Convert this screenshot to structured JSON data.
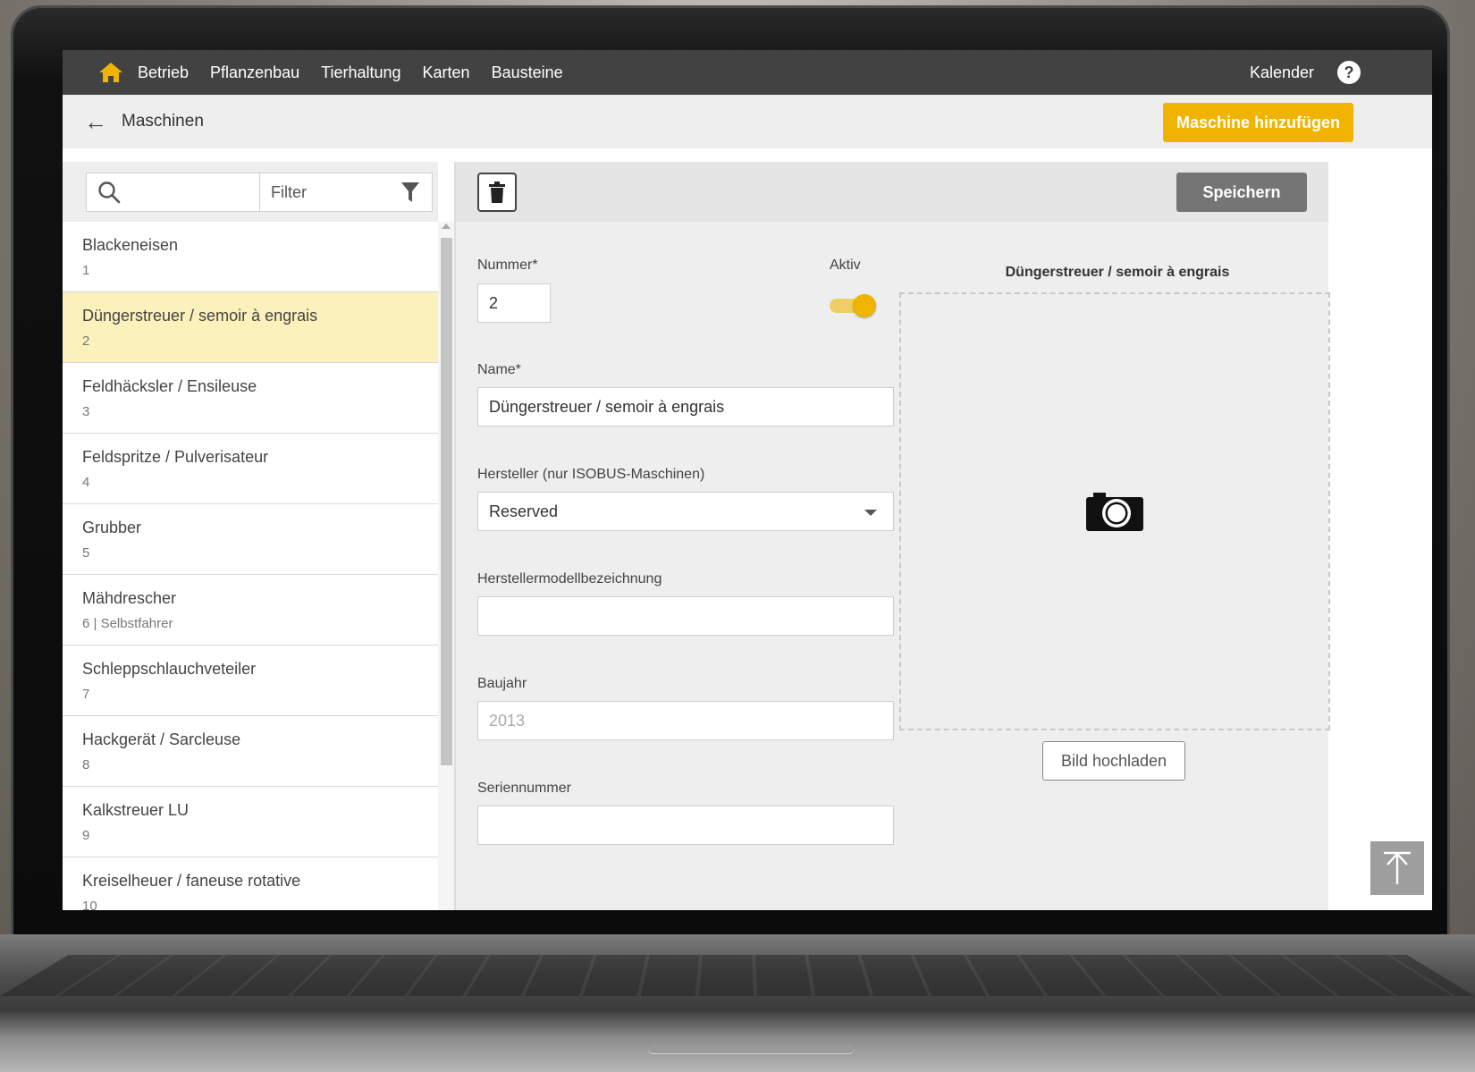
{
  "nav": {
    "items": [
      "Betrieb",
      "Pflanzenbau",
      "Tierhaltung",
      "Karten",
      "Bausteine"
    ],
    "calendar": "Kalender",
    "help": "?"
  },
  "header": {
    "back_icon": "arrow-left-icon",
    "title": "Maschinen",
    "add_button": "Maschine hinzufügen"
  },
  "list": {
    "search_icon": "search-icon",
    "filter_label": "Filter",
    "filter_icon": "funnel-icon",
    "items": [
      {
        "name": "Blackeneisen",
        "sub": "1"
      },
      {
        "name": "Düngerstreuer / semoir à engrais",
        "sub": "2",
        "selected": true
      },
      {
        "name": "Feldhäcksler / Ensileuse",
        "sub": "3"
      },
      {
        "name": "Feldspritze / Pulverisateur",
        "sub": "4"
      },
      {
        "name": "Grubber",
        "sub": "5"
      },
      {
        "name": "Mähdrescher",
        "sub": "6 | Selbstfahrer"
      },
      {
        "name": "Schleppschlauchveteiler",
        "sub": "7"
      },
      {
        "name": "Hackgerät / Sarcleuse",
        "sub": "8"
      },
      {
        "name": "Kalkstreuer LU",
        "sub": "9"
      },
      {
        "name": "Kreiselheuer / faneuse rotative",
        "sub": "10"
      }
    ]
  },
  "detail": {
    "delete_icon": "trash-icon",
    "save_button": "Speichern",
    "nummer_label": "Nummer*",
    "nummer_value": "2",
    "aktiv_label": "Aktiv",
    "aktiv_value": true,
    "name_label": "Name*",
    "name_value": "Düngerstreuer / semoir à engrais",
    "hersteller_label": "Hersteller (nur ISOBUS-Maschinen)",
    "hersteller_value": "Reserved",
    "modell_label": "Herstellermodellbezeichnung",
    "modell_value": "",
    "baujahr_label": "Baujahr",
    "baujahr_placeholder": "2013",
    "serien_label": "Seriennummer",
    "serien_value": "",
    "image_title": "Düngerstreuer / semoir à engrais",
    "camera_icon": "camera-icon",
    "upload_button": "Bild hochladen"
  },
  "colors": {
    "accent": "#f0b400",
    "nav_bg": "#424242",
    "selected_row": "#faf1bb",
    "save_bg": "#757575"
  }
}
